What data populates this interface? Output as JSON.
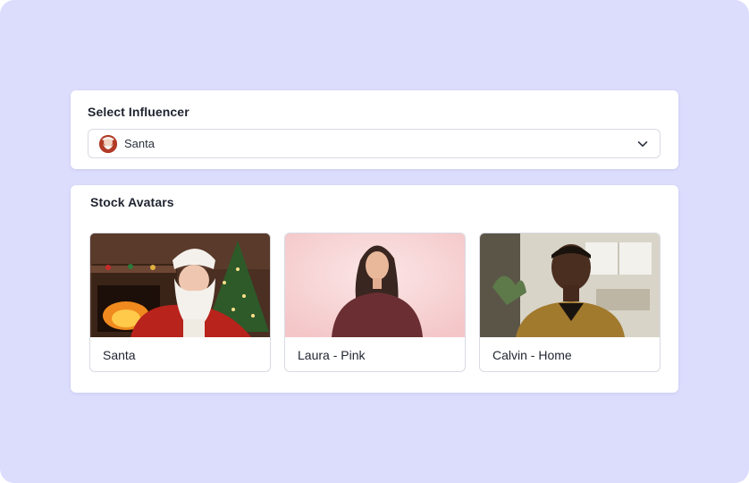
{
  "influencer_select": {
    "title": "Select Influencer",
    "selected_value": "Santa",
    "avatar_icon": "santa-avatar",
    "chevron_icon": "chevron-down-icon"
  },
  "stock_avatars": {
    "title": "Stock Avatars",
    "items": [
      {
        "label": "Santa"
      },
      {
        "label": "Laura - Pink"
      },
      {
        "label": "Calvin - Home"
      }
    ]
  },
  "colors": {
    "page_background": "#dcdcfd",
    "card_background": "#ffffff",
    "border": "#d9dbe3"
  }
}
